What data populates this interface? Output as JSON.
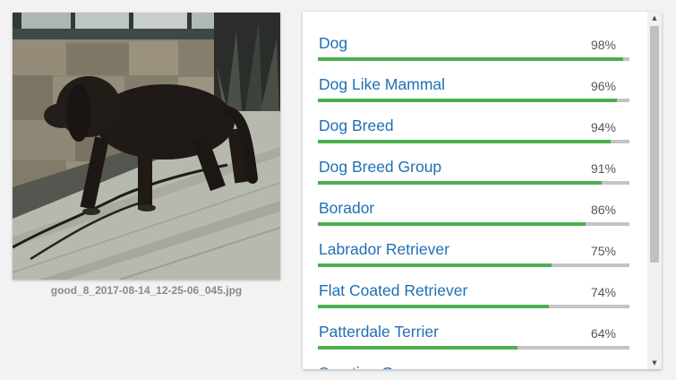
{
  "image": {
    "filename": "good_8_2017-08-14_12-25-06_045.jpg",
    "description_icon": "dog-photo"
  },
  "labels": [
    {
      "name": "Dog",
      "score": "98%",
      "fraction": 0.98
    },
    {
      "name": "Dog Like Mammal",
      "score": "96%",
      "fraction": 0.96
    },
    {
      "name": "Dog Breed",
      "score": "94%",
      "fraction": 0.94
    },
    {
      "name": "Dog Breed Group",
      "score": "91%",
      "fraction": 0.91
    },
    {
      "name": "Borador",
      "score": "86%",
      "fraction": 0.86
    },
    {
      "name": "Labrador Retriever",
      "score": "75%",
      "fraction": 0.75
    },
    {
      "name": "Flat Coated Retriever",
      "score": "74%",
      "fraction": 0.74
    },
    {
      "name": "Patterdale Terrier",
      "score": "64%",
      "fraction": 0.64
    },
    {
      "name": "Sporting Group",
      "score": "",
      "fraction": 0
    }
  ],
  "colors": {
    "label_text": "#1f6fb5",
    "bar_fill": "#4caf50",
    "bar_track": "#c4c4c4"
  },
  "scrollbar": {
    "up_icon": "scroll-up-arrow-icon",
    "down_icon": "scroll-down-arrow-icon"
  }
}
